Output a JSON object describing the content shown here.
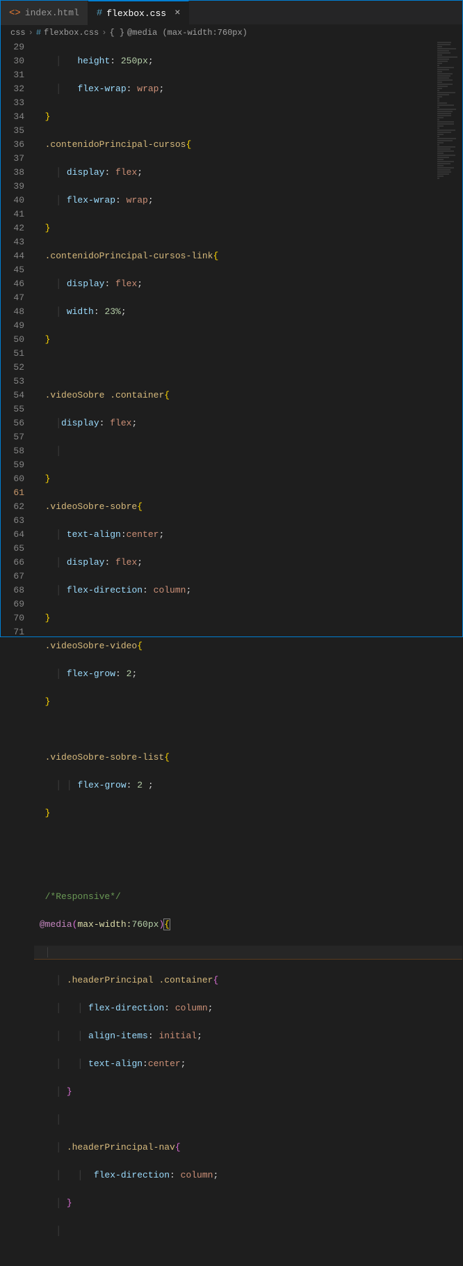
{
  "tabs": [
    {
      "label": "index.html",
      "icon": "<>"
    },
    {
      "label": "flexbox.css",
      "icon": "#"
    }
  ],
  "breadcrumb": {
    "p1": "css",
    "p2": "flexbox.css",
    "p3": "@media (max-width:760px)",
    "icon_css": "#",
    "icon_brace": "{ }"
  },
  "gutter": [
    "29",
    "30",
    "31",
    "32",
    "33",
    "34",
    "35",
    "36",
    "37",
    "38",
    "39",
    "40",
    "41",
    "42",
    "43",
    "44",
    "45",
    "46",
    "47",
    "48",
    "49",
    "50",
    "51",
    "52",
    "53",
    "54",
    "55",
    "56",
    "57",
    "58",
    "59",
    "60",
    "61",
    "62",
    "63",
    "64",
    "65",
    "66",
    "67",
    "68",
    "69",
    "70",
    "71"
  ],
  "code": {
    "l29": {
      "prop": "height",
      "val": "250px"
    },
    "l30": {
      "prop": "flex-wrap",
      "val": "wrap"
    },
    "l32": {
      "sel": ".contenidoPrincipal-cursos"
    },
    "l33": {
      "prop": "display",
      "val": "flex"
    },
    "l34": {
      "prop": "flex-wrap",
      "val": "wrap"
    },
    "l36": {
      "sel": ".contenidoPrincipal-cursos-link"
    },
    "l37": {
      "prop": "display",
      "val": "flex"
    },
    "l38": {
      "prop": "width",
      "val": "23%"
    },
    "l41": {
      "sel1": ".videoSobre ",
      "sel2": ".container"
    },
    "l42": {
      "prop": "display",
      "val": "flex"
    },
    "l45": {
      "sel": ".videoSobre-sobre"
    },
    "l46": {
      "prop": "text-align",
      "val": "center"
    },
    "l47": {
      "prop": "display",
      "val": "flex"
    },
    "l48": {
      "prop": "flex-direction",
      "val": "column"
    },
    "l50": {
      "sel": ".videoSobre-video"
    },
    "l51": {
      "prop": "flex-grow",
      "val": "2"
    },
    "l54": {
      "sel": ".videoSobre-sobre-list"
    },
    "l55": {
      "prop": "flex-grow",
      "val": "2 "
    },
    "l59": {
      "com": "/*Responsive*/"
    },
    "l60": {
      "kw": "@media",
      "fn": "max-width:",
      "num": "760px"
    },
    "l62": {
      "sel1": ".headerPrincipal ",
      "sel2": ".container"
    },
    "l63": {
      "prop": "flex-direction",
      "val": "column"
    },
    "l64": {
      "prop": "align-items",
      "val": "initial"
    },
    "l65": {
      "prop": "text-align",
      "val": "center"
    },
    "l68": {
      "sel": ".headerPrincipal-nav"
    },
    "l69": {
      "prop": "flex-direction",
      "val": "column"
    }
  }
}
